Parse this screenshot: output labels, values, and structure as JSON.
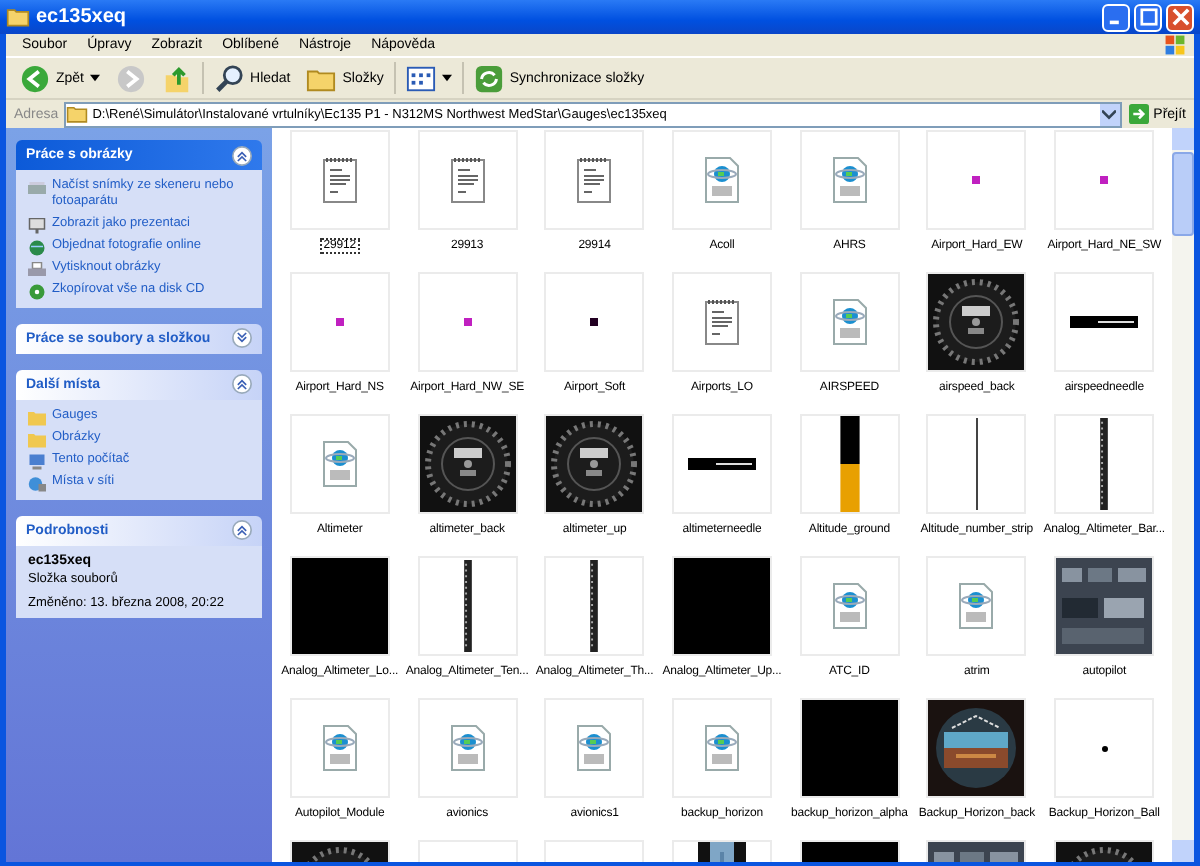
{
  "window": {
    "title": "ec135xeq"
  },
  "menu": [
    "Soubor",
    "Úpravy",
    "Zobrazit",
    "Oblíbené",
    "Nástroje",
    "Nápověda"
  ],
  "toolbar": {
    "back": "Zpět",
    "search": "Hledat",
    "folders": "Složky",
    "sync": "Synchronizace složky"
  },
  "address": {
    "label": "Adresa",
    "value": "D:\\René\\Simulátor\\Instalované vrtulníky\\Ec135 P1 - N312MS Northwest MedStar\\Gauges\\ec135xeq",
    "go": "Přejít"
  },
  "sidebar": [
    {
      "title": "Práce s obrázky",
      "kind": "tasks",
      "expanded": true,
      "items": [
        {
          "label": "Načíst snímky ze skeneru nebo fotoaparátu"
        },
        {
          "label": "Zobrazit jako prezentaci"
        },
        {
          "label": "Objednat fotografie online"
        },
        {
          "label": "Vytisknout obrázky"
        },
        {
          "label": "Zkopírovat vše na disk CD"
        }
      ]
    },
    {
      "title": "Práce se soubory a složkou",
      "expanded": false
    },
    {
      "title": "Další místa",
      "kind": "places",
      "expanded": true,
      "items": [
        {
          "label": "Gauges"
        },
        {
          "label": "Obrázky"
        },
        {
          "label": "Tento počítač"
        },
        {
          "label": "Místa v síti"
        }
      ]
    },
    {
      "title": "Podrobnosti",
      "kind": "details",
      "expanded": true,
      "name": "ec135xeq",
      "type": "Složka souborů",
      "modified": "Změněno: 13. března 2008, 20:22"
    }
  ],
  "files": [
    {
      "label": "29912",
      "kind": "text",
      "focused": true
    },
    {
      "label": "29913",
      "kind": "text",
      "focused": false
    },
    {
      "label": "29914",
      "kind": "text",
      "focused": false
    },
    {
      "label": "Acoll",
      "kind": "web",
      "focused": false
    },
    {
      "label": "AHRS",
      "kind": "web",
      "focused": false
    },
    {
      "label": "Airport_Hard_EW",
      "kind": "dot",
      "focused": false
    },
    {
      "label": "Airport_Hard_NE_SW",
      "kind": "dot",
      "focused": false
    },
    {
      "label": "Airport_Hard_NS",
      "kind": "dot",
      "focused": false
    },
    {
      "label": "Airport_Hard_NW_SE",
      "kind": "dot",
      "focused": false
    },
    {
      "label": "Airport_Soft",
      "kind": "darkdot",
      "focused": false
    },
    {
      "label": "Airports_LO",
      "kind": "text",
      "focused": false
    },
    {
      "label": "AIRSPEED",
      "kind": "web",
      "focused": false
    },
    {
      "label": "airspeed_back",
      "kind": "dial",
      "focused": false
    },
    {
      "label": "airspeedneedle",
      "kind": "needle",
      "focused": false
    },
    {
      "label": "Altimeter",
      "kind": "web",
      "focused": false
    },
    {
      "label": "altimeter_back",
      "kind": "dial",
      "focused": false
    },
    {
      "label": "altimeter_up",
      "kind": "dial",
      "focused": false
    },
    {
      "label": "altimeterneedle",
      "kind": "needle",
      "focused": false
    },
    {
      "label": "Altitude_ground",
      "kind": "ground",
      "focused": false
    },
    {
      "label": "Altitude_number_strip",
      "kind": "line",
      "focused": false
    },
    {
      "label": "Analog_Altimeter_Bar...",
      "kind": "strip",
      "focused": false
    },
    {
      "label": "Analog_Altimeter_Lo...",
      "kind": "black",
      "focused": false
    },
    {
      "label": "Analog_Altimeter_Ten...",
      "kind": "strip",
      "focused": false
    },
    {
      "label": "Analog_Altimeter_Th...",
      "kind": "strip",
      "focused": false
    },
    {
      "label": "Analog_Altimeter_Up...",
      "kind": "black",
      "focused": false
    },
    {
      "label": "ATC_ID",
      "kind": "web",
      "focused": false
    },
    {
      "label": "atrim",
      "kind": "web",
      "focused": false
    },
    {
      "label": "autopilot",
      "kind": "panel",
      "focused": false
    },
    {
      "label": "Autopilot_Module",
      "kind": "web",
      "focused": false
    },
    {
      "label": "avionics",
      "kind": "web",
      "focused": false
    },
    {
      "label": "avionics1",
      "kind": "web",
      "focused": false
    },
    {
      "label": "backup_horizon",
      "kind": "web",
      "focused": false
    },
    {
      "label": "backup_horizon_alpha",
      "kind": "black",
      "focused": false
    },
    {
      "label": "Backup_Horizon_back",
      "kind": "horizon",
      "focused": false
    },
    {
      "label": "Backup_Horizon_Ball",
      "kind": "ball",
      "focused": false
    },
    {
      "kind": "dial"
    },
    {
      "kind": "blank"
    },
    {
      "kind": "blank"
    },
    {
      "kind": "bar"
    },
    {
      "kind": "black"
    },
    {
      "kind": "panel"
    },
    {
      "kind": "dial"
    }
  ]
}
